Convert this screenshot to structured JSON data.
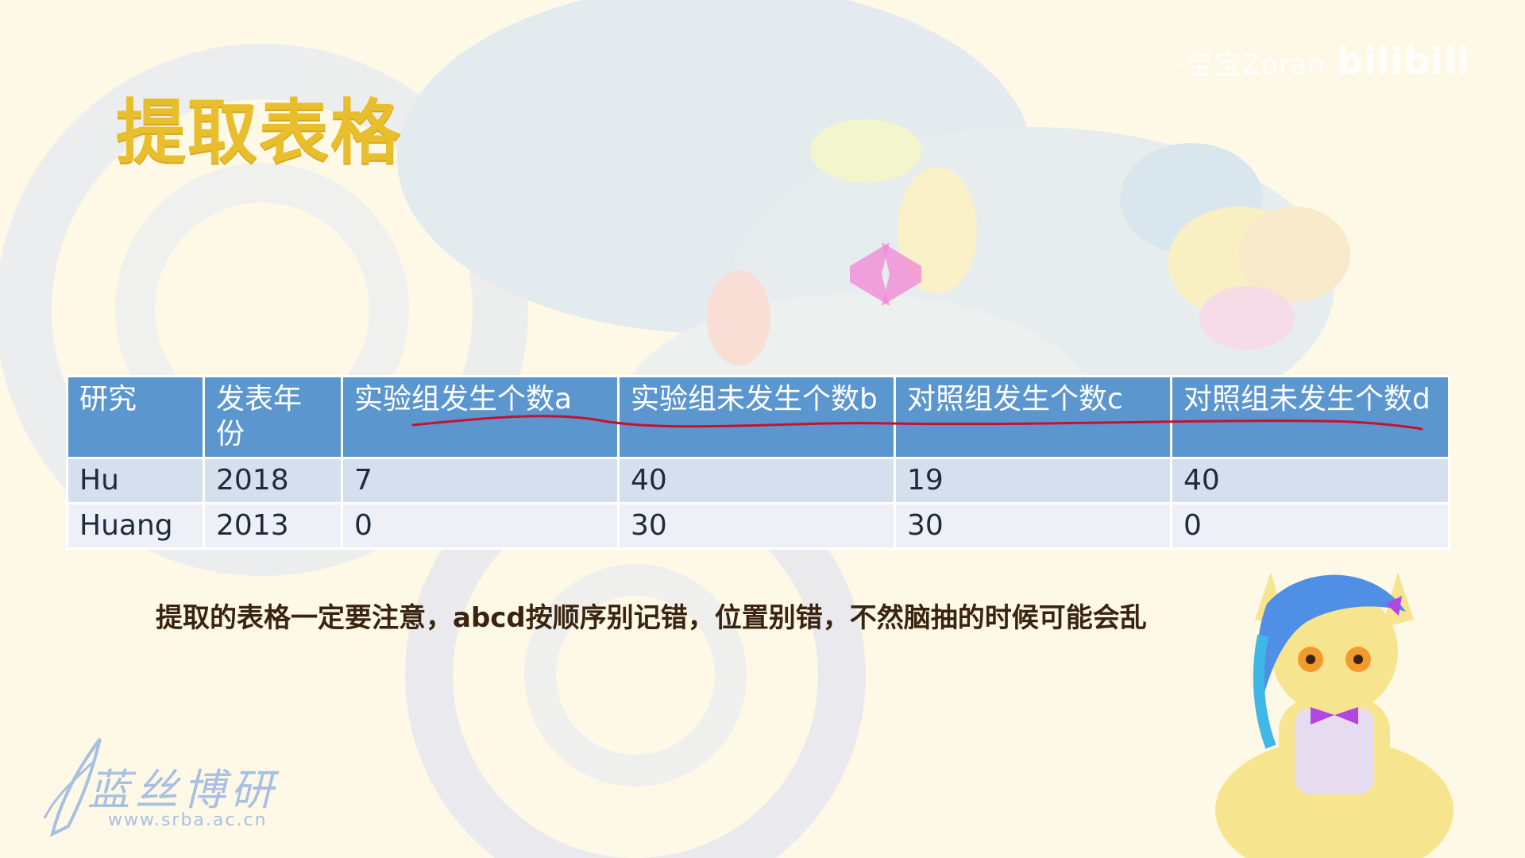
{
  "slide": {
    "title": "提取表格"
  },
  "watermark": {
    "text": "··宝宝Zoran",
    "brand": "bilibili"
  },
  "table": {
    "headers": [
      "研究",
      "发表年份",
      "实验组发生个数a",
      "实验组未发生个数b",
      "对照组发生个数c",
      "对照组未发生个数d"
    ],
    "rows": [
      [
        "Hu",
        "2018",
        "7",
        "40",
        "19",
        "40"
      ],
      [
        "Huang",
        "2013",
        "0",
        "30",
        "30",
        "0"
      ]
    ]
  },
  "note": "提取的表格一定要注意，abcd按顺序别记错，位置别错，不然脑抽的时候可能会乱",
  "logo": {
    "text": "蓝丝博研",
    "url": "www.srba.ac.cn"
  },
  "colors": {
    "title": "#e9be2c",
    "header_bg": "#5b96cf",
    "row1_bg": "#d6dfee",
    "row2_bg": "#edf0f7",
    "annotation": "#c8102e",
    "note_text": "#3a2410"
  },
  "icons": {
    "logo": "quill-logo-icon",
    "avatar": "pony-avatar-icon"
  }
}
